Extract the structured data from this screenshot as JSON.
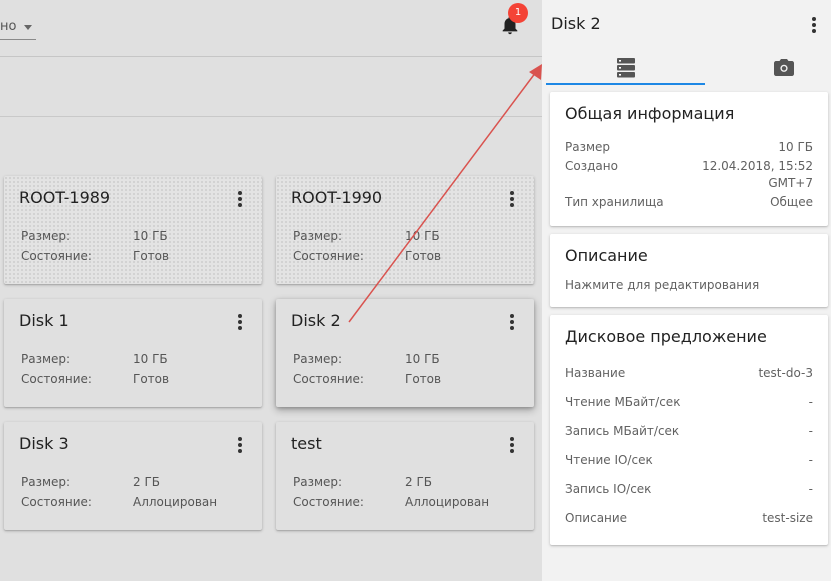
{
  "topbar": {
    "select_value": "но",
    "notification_count": "1"
  },
  "cards": [
    {
      "title": "ROOT-1989",
      "size_label": "Размер:",
      "size": "10 ГБ",
      "state_label": "Состояние:",
      "state": "Готов"
    },
    {
      "title": "ROOT-1990",
      "size_label": "Размер:",
      "size": "10 ГБ",
      "state_label": "Состояние:",
      "state": "Готов"
    },
    {
      "title": "Disk 1",
      "size_label": "Размер:",
      "size": "10 ГБ",
      "state_label": "Состояние:",
      "state": "Готов"
    },
    {
      "title": "Disk 2",
      "size_label": "Размер:",
      "size": "10 ГБ",
      "state_label": "Состояние:",
      "state": "Готов"
    },
    {
      "title": "Disk 3",
      "size_label": "Размер:",
      "size": "2 ГБ",
      "state_label": "Состояние:",
      "state": "Аллоцирован"
    },
    {
      "title": "test",
      "size_label": "Размер:",
      "size": "2 ГБ",
      "state_label": "Состояние:",
      "state": "Аллоцирован"
    }
  ],
  "sidebar": {
    "title": "Disk 2",
    "tabs": [
      {
        "icon": "storage-icon",
        "active": true
      },
      {
        "icon": "camera-icon",
        "active": false
      }
    ],
    "general": {
      "heading": "Общая информация",
      "size_label": "Размер",
      "size": "10 ГБ",
      "created_label": "Создано",
      "created_line1": "12.04.2018, 15:52",
      "created_line2": "GMT+7",
      "storage_label": "Тип хранилища",
      "storage": "Общее"
    },
    "description": {
      "heading": "Описание",
      "hint": "Нажмите для редактирования"
    },
    "offering": {
      "heading": "Дисковое предложение",
      "rows": [
        {
          "label": "Название",
          "value": "test-do-3"
        },
        {
          "label": "Чтение МБайт/сек",
          "value": "-"
        },
        {
          "label": "Запись МБайт/сек",
          "value": "-"
        },
        {
          "label": "Чтение IO/сек",
          "value": "-"
        },
        {
          "label": "Запись IO/сек",
          "value": "-"
        },
        {
          "label": "Описание",
          "value": "test-size"
        }
      ]
    }
  },
  "colors": {
    "accent": "#1e88e5",
    "badge": "#f44336",
    "arrow": "#d9534f"
  }
}
